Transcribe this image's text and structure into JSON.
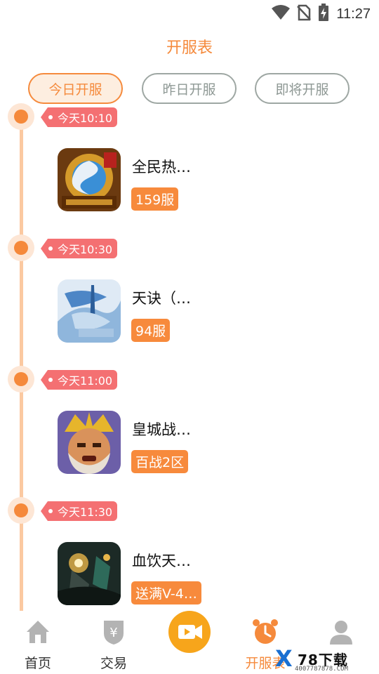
{
  "status_bar": {
    "time": "11:27",
    "icons": [
      "wifi-icon",
      "no-sim-icon",
      "battery-charging-icon"
    ]
  },
  "header": {
    "title": "开服表"
  },
  "tabs": [
    {
      "label": "今日开服",
      "active": true
    },
    {
      "label": "昨日开服",
      "active": false
    },
    {
      "label": "即将开服",
      "active": false
    }
  ],
  "timeline": [
    {
      "time": "今天10:10",
      "game": {
        "name": "全民热…",
        "server": "159服",
        "icon": "golden-dragon-game-icon"
      }
    },
    {
      "time": "今天10:30",
      "game": {
        "name": "天诀（…",
        "server": "94服",
        "icon": "blue-sword-game-icon"
      }
    },
    {
      "time": "今天11:00",
      "game": {
        "name": "皇城战…",
        "server": "百战2区",
        "icon": "warrior-face-game-icon"
      }
    },
    {
      "time": "今天11:30",
      "game": {
        "name": "血饮天…",
        "server": "送满V-4…",
        "icon": "dark-battle-game-icon"
      }
    }
  ],
  "bottom_nav": [
    {
      "label": "首页",
      "icon": "home-icon",
      "active": false
    },
    {
      "label": "交易",
      "icon": "yuan-shield-icon",
      "active": false
    },
    {
      "label": "",
      "icon": "video-camera-icon",
      "active": false
    },
    {
      "label": "开服表",
      "icon": "alarm-clock-icon",
      "active": true
    },
    {
      "label": "",
      "icon": "user-icon",
      "active": false
    }
  ],
  "watermark": {
    "logo": "X",
    "text": "78下载",
    "url": "4007787878.COM"
  },
  "colors": {
    "accent": "#f58a3c",
    "tag": "#f47072",
    "badge": "#f78a3c",
    "timeline": "#fbc9a1"
  }
}
